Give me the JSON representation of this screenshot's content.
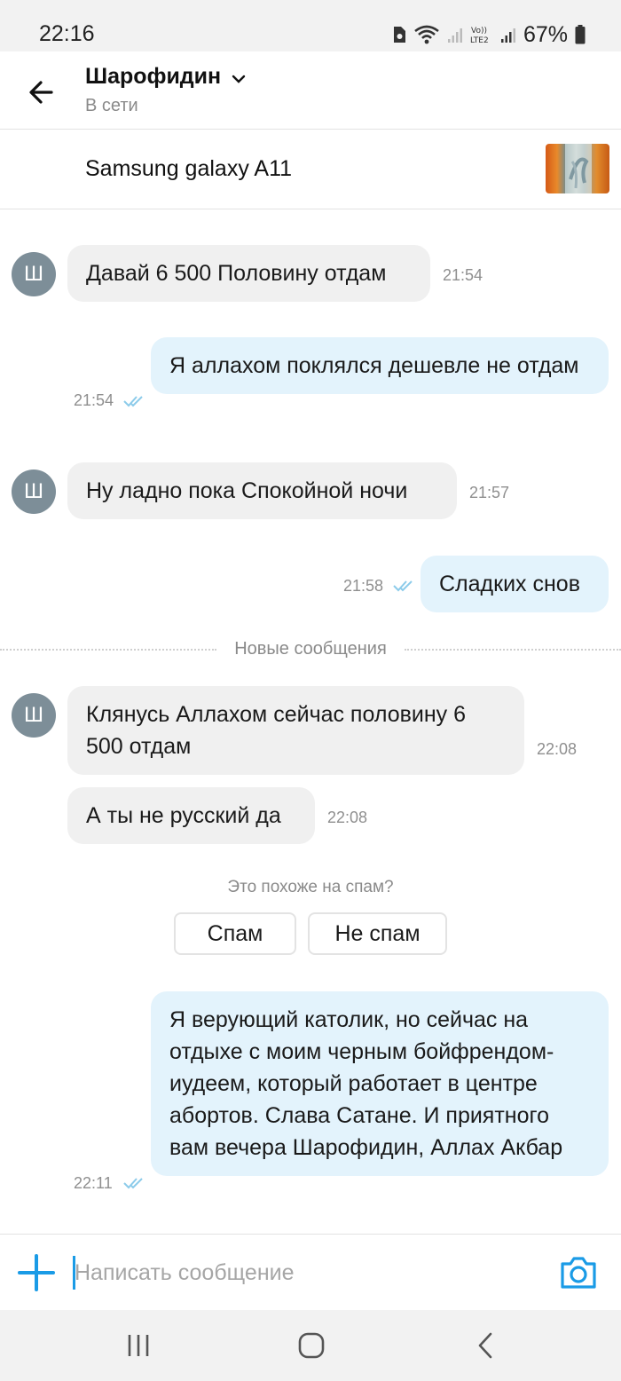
{
  "status_bar": {
    "time": "22:16",
    "battery": "67%",
    "icons": [
      "sim-icon",
      "wifi-icon",
      "signal-icon",
      "volte-icon",
      "signal-icon",
      "battery-icon"
    ]
  },
  "header": {
    "name": "Шарофидин",
    "status": "В сети"
  },
  "product": {
    "title": "Samsung galaxy A11"
  },
  "avatar_letter": "Ш",
  "messages": [
    {
      "dir": "in",
      "text": "Давай 6 500 Половину отдам",
      "time": "21:54"
    },
    {
      "dir": "out",
      "text": "Я аллахом поклялся дешевле не отдам",
      "time": "21:54",
      "read": true
    },
    {
      "dir": "in",
      "text": "Ну ладно пока Спокойной ночи",
      "time": "21:57"
    },
    {
      "dir": "out",
      "text": "Сладких снов",
      "time": "21:58",
      "read": true
    },
    {
      "dir": "in",
      "text": "Клянусь Аллахом сейчас половину 6 500  отдам",
      "time": "22:08"
    },
    {
      "dir": "in",
      "text": "А ты не русский да",
      "time": "22:08"
    },
    {
      "dir": "out",
      "text": "Я верующий католик, но сейчас на отдыхе с моим черным бойфрендом-иудеем, который работает в центре абортов. Слава Сатане. И приятного вам вечера Шарофидин, Аллах Акбар",
      "time": "22:11",
      "read": true
    }
  ],
  "divider": {
    "label": "Новые сообщения"
  },
  "spam": {
    "question": "Это похоже на спам?",
    "spam_label": "Спам",
    "not_spam_label": "Не спам"
  },
  "composer": {
    "placeholder": "Написать сообщение",
    "value": ""
  },
  "colors": {
    "accent": "#1a9be6",
    "incoming_bubble": "#f0f0f0",
    "outgoing_bubble": "#e3f3fc",
    "avatar": "#7d8e98",
    "read_checks": "#8ccbea"
  }
}
